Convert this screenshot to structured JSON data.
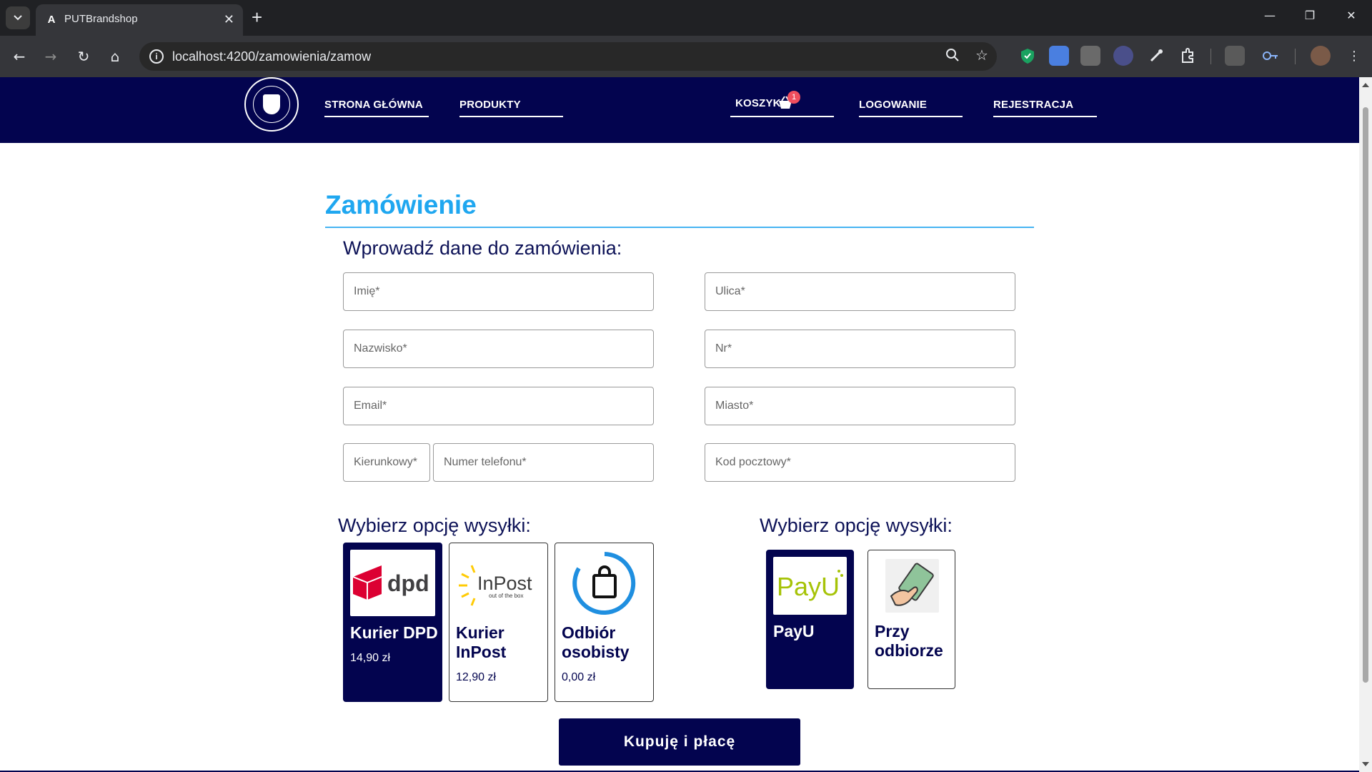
{
  "browser": {
    "tab_title": "PUTBrandshop",
    "tab_favicon": "A",
    "tab_close": "✕",
    "new_tab": "+",
    "url": "localhost:4200/zamowienia/zamow",
    "window_controls": {
      "minimize": "—",
      "maximize": "❐",
      "close": "✕"
    }
  },
  "site": {
    "nav": {
      "home": "STRONA GŁÓWNA",
      "products": "PRODUKTY",
      "cart": "KOSZYK",
      "cart_count": "1",
      "login": "LOGOWANIE",
      "register": "REJESTRACJA"
    }
  },
  "order": {
    "title": "Zamówienie",
    "form_heading": "Wprowadź dane do zamówienia:",
    "fields": {
      "first_name": "Imię*",
      "last_name": "Nazwisko*",
      "email": "Email*",
      "area_code": "Kierunkowy*",
      "phone": "Numer telefonu*",
      "street": "Ulica*",
      "number": "Nr*",
      "city": "Miasto*",
      "postal_code": "Kod pocztowy*"
    },
    "shipping_heading": "Wybierz opcję wysyłki:",
    "shipping": [
      {
        "name": "Kurier DPD",
        "price": "14,90 zł",
        "logo": "dpd",
        "selected": true
      },
      {
        "name": "Kurier InPost",
        "price": "12,90 zł",
        "logo": "InPost",
        "logo_sub": "out of the box",
        "selected": false
      },
      {
        "name": "Odbiór osobisty",
        "price": "0,00 zł",
        "logo": "shopping-bag-icon",
        "selected": false
      }
    ],
    "payment_heading": "Wybierz opcję wysyłki:",
    "payment": [
      {
        "name": "PayU",
        "logo": "PayU",
        "selected": true
      },
      {
        "name": "Przy odbiorze",
        "logo": "cash-hand-icon",
        "selected": false
      }
    ],
    "submit_label": "Kupuję i płacę"
  },
  "colors": {
    "navy": "#03044f",
    "title_blue": "#1fa7f0",
    "dpd_red": "#dc0032",
    "inpost_yellow": "#ffcb05",
    "payu_green": "#a6c307",
    "bag_blue": "#1f8fe0"
  }
}
